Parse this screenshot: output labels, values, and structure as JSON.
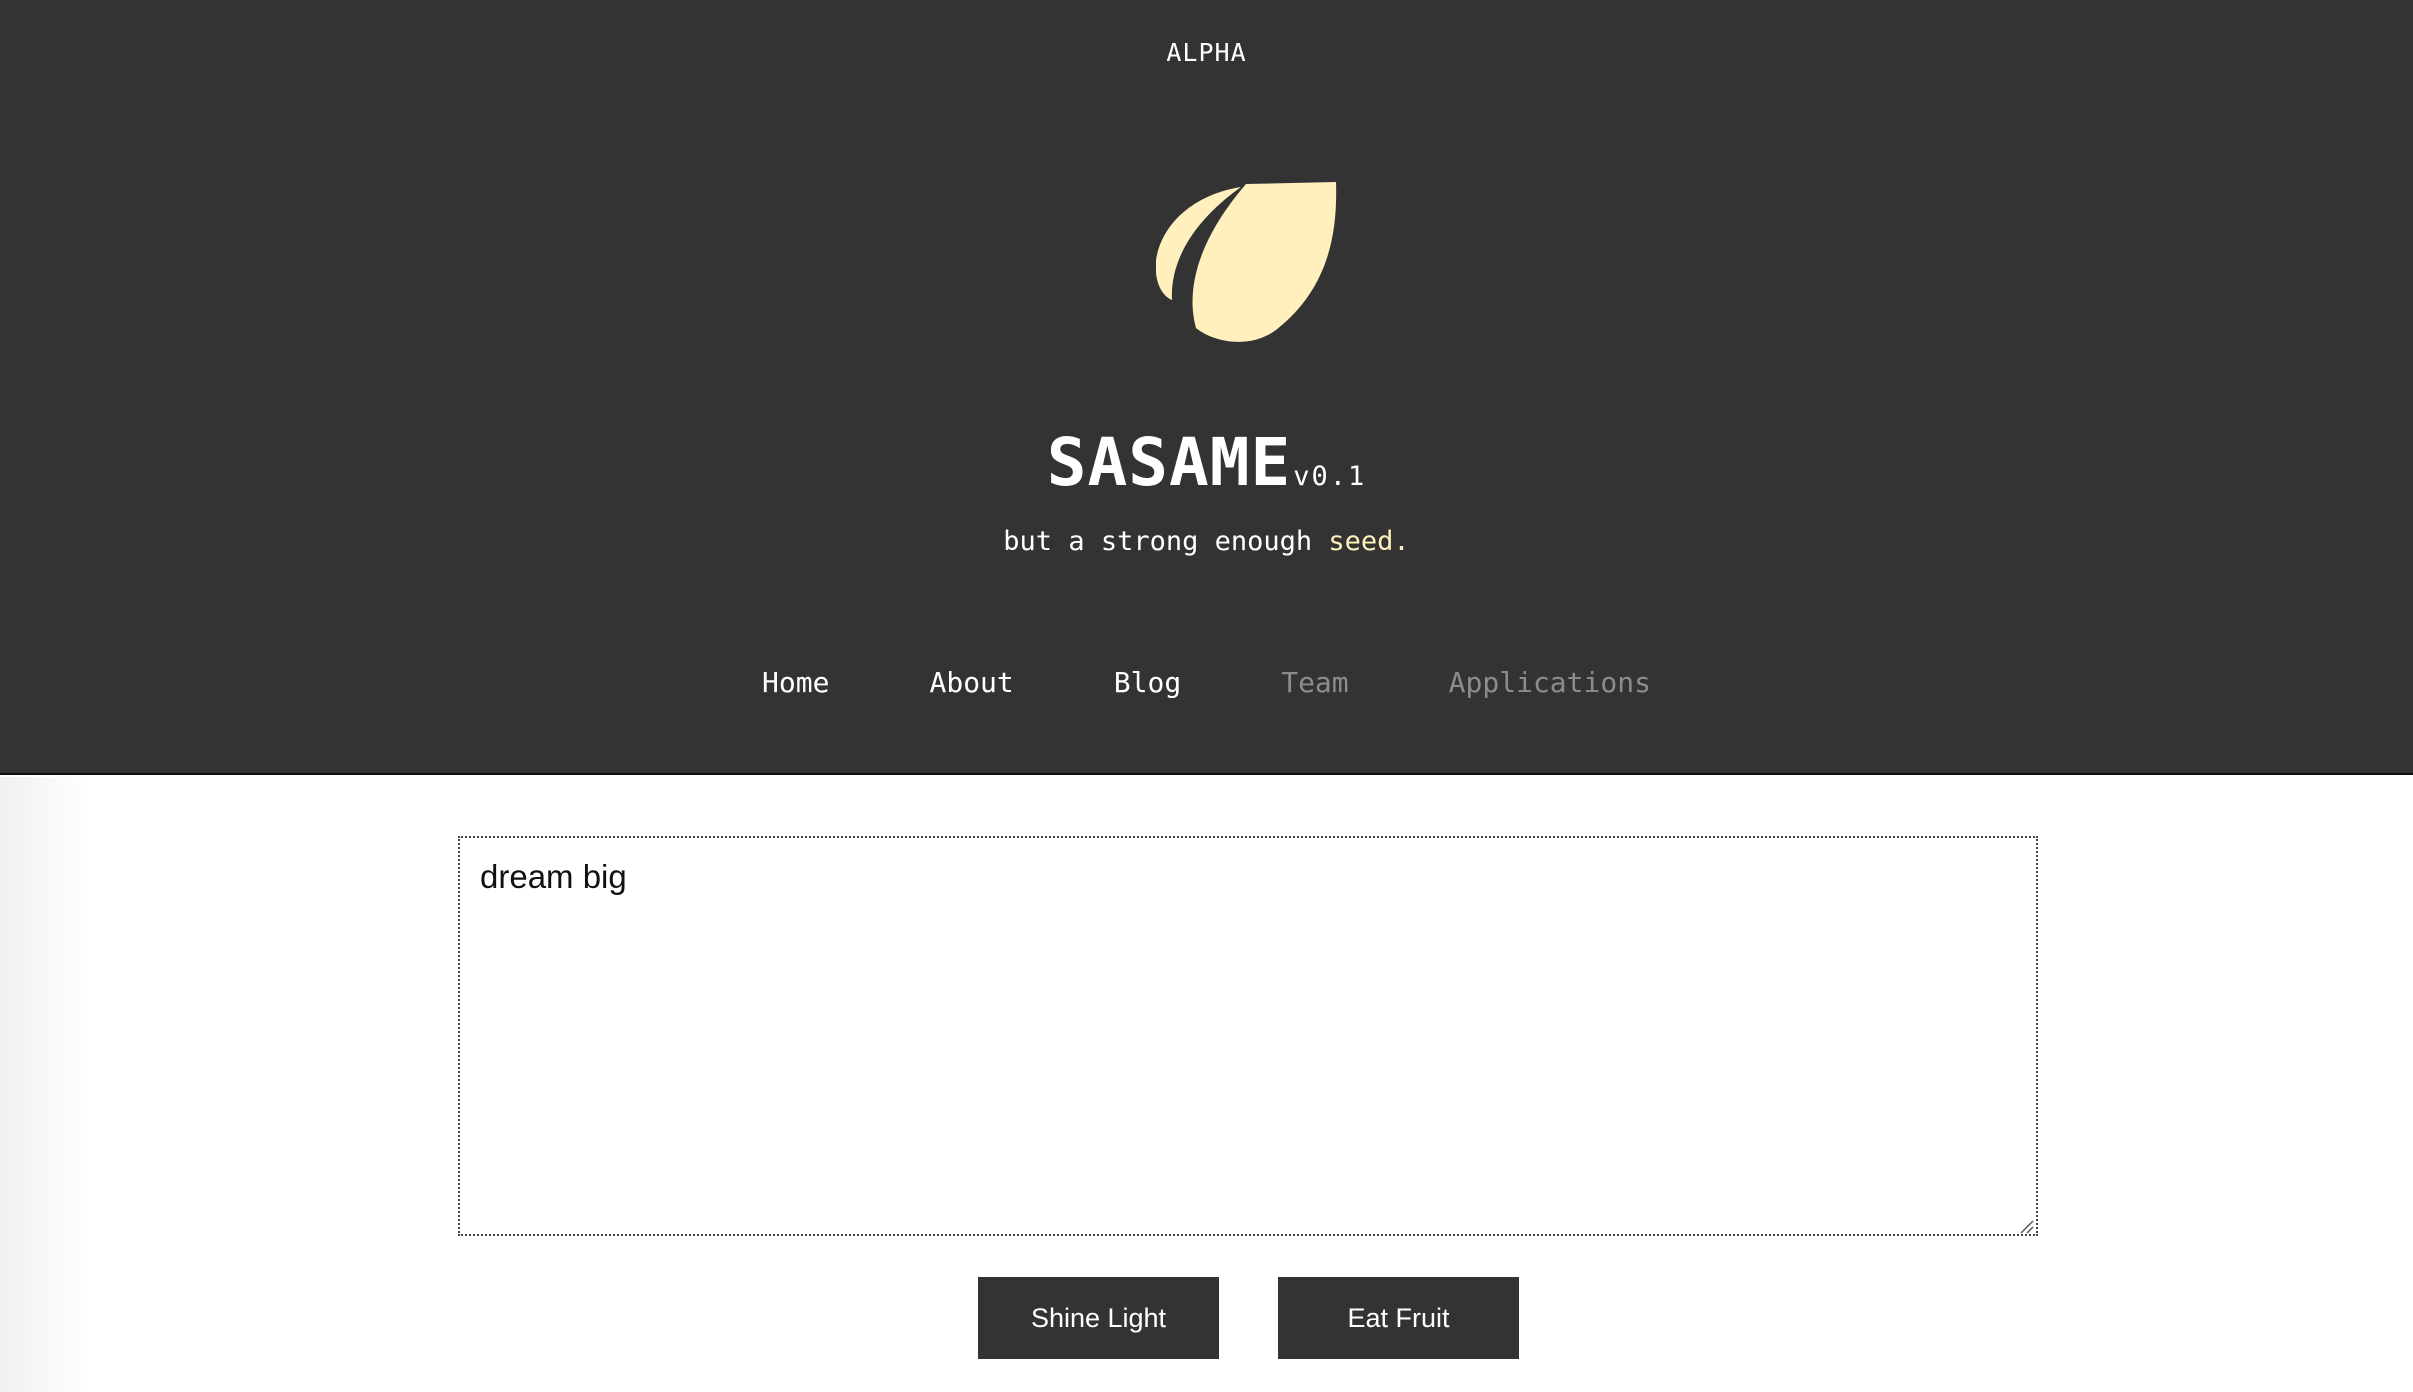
{
  "header": {
    "badge": "ALPHA",
    "title": "SASAME",
    "version": "v0.1",
    "tagline_prefix": "but a strong enough ",
    "tagline_accent": "seed.",
    "logo_icon": "seed-icon",
    "colors": {
      "background": "#333333",
      "accent": "#fff0be",
      "text": "#ffffff",
      "muted": "#8c8c8c"
    }
  },
  "nav": {
    "items": [
      {
        "label": "Home",
        "enabled": true
      },
      {
        "label": "About",
        "enabled": true
      },
      {
        "label": "Blog",
        "enabled": true
      },
      {
        "label": "Team",
        "enabled": false
      },
      {
        "label": "Applications",
        "enabled": false
      }
    ]
  },
  "editor": {
    "value": "dream big"
  },
  "actions": {
    "shine_label": "Shine Light",
    "eat_label": "Eat Fruit"
  }
}
